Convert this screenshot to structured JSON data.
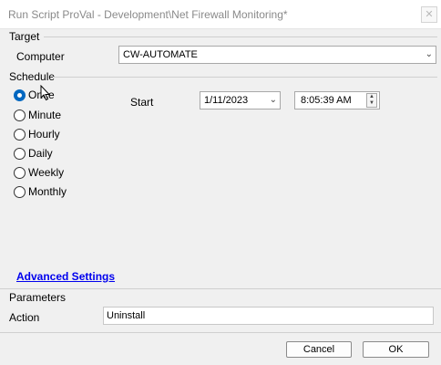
{
  "window": {
    "title": "Run Script ProVal - Development\\Net Firewall Monitoring*",
    "close_glyph": "✕"
  },
  "target": {
    "heading": "Target",
    "computer_label": "Computer",
    "computer_value": "CW-AUTOMATE"
  },
  "schedule": {
    "heading": "Schedule",
    "options": [
      "Once",
      "Minute",
      "Hourly",
      "Daily",
      "Weekly",
      "Monthly"
    ],
    "selected": "Once",
    "start_label": "Start",
    "start_date": "1/11/2023",
    "start_time": "8:05:39 AM"
  },
  "advanced_link": "Advanced Settings",
  "parameters": {
    "heading": "Parameters",
    "action_label": "Action",
    "action_value": "Uninstall"
  },
  "buttons": {
    "cancel": "Cancel",
    "ok": "OK"
  },
  "colors": {
    "accent": "#0067c0",
    "link": "#0000ee"
  }
}
